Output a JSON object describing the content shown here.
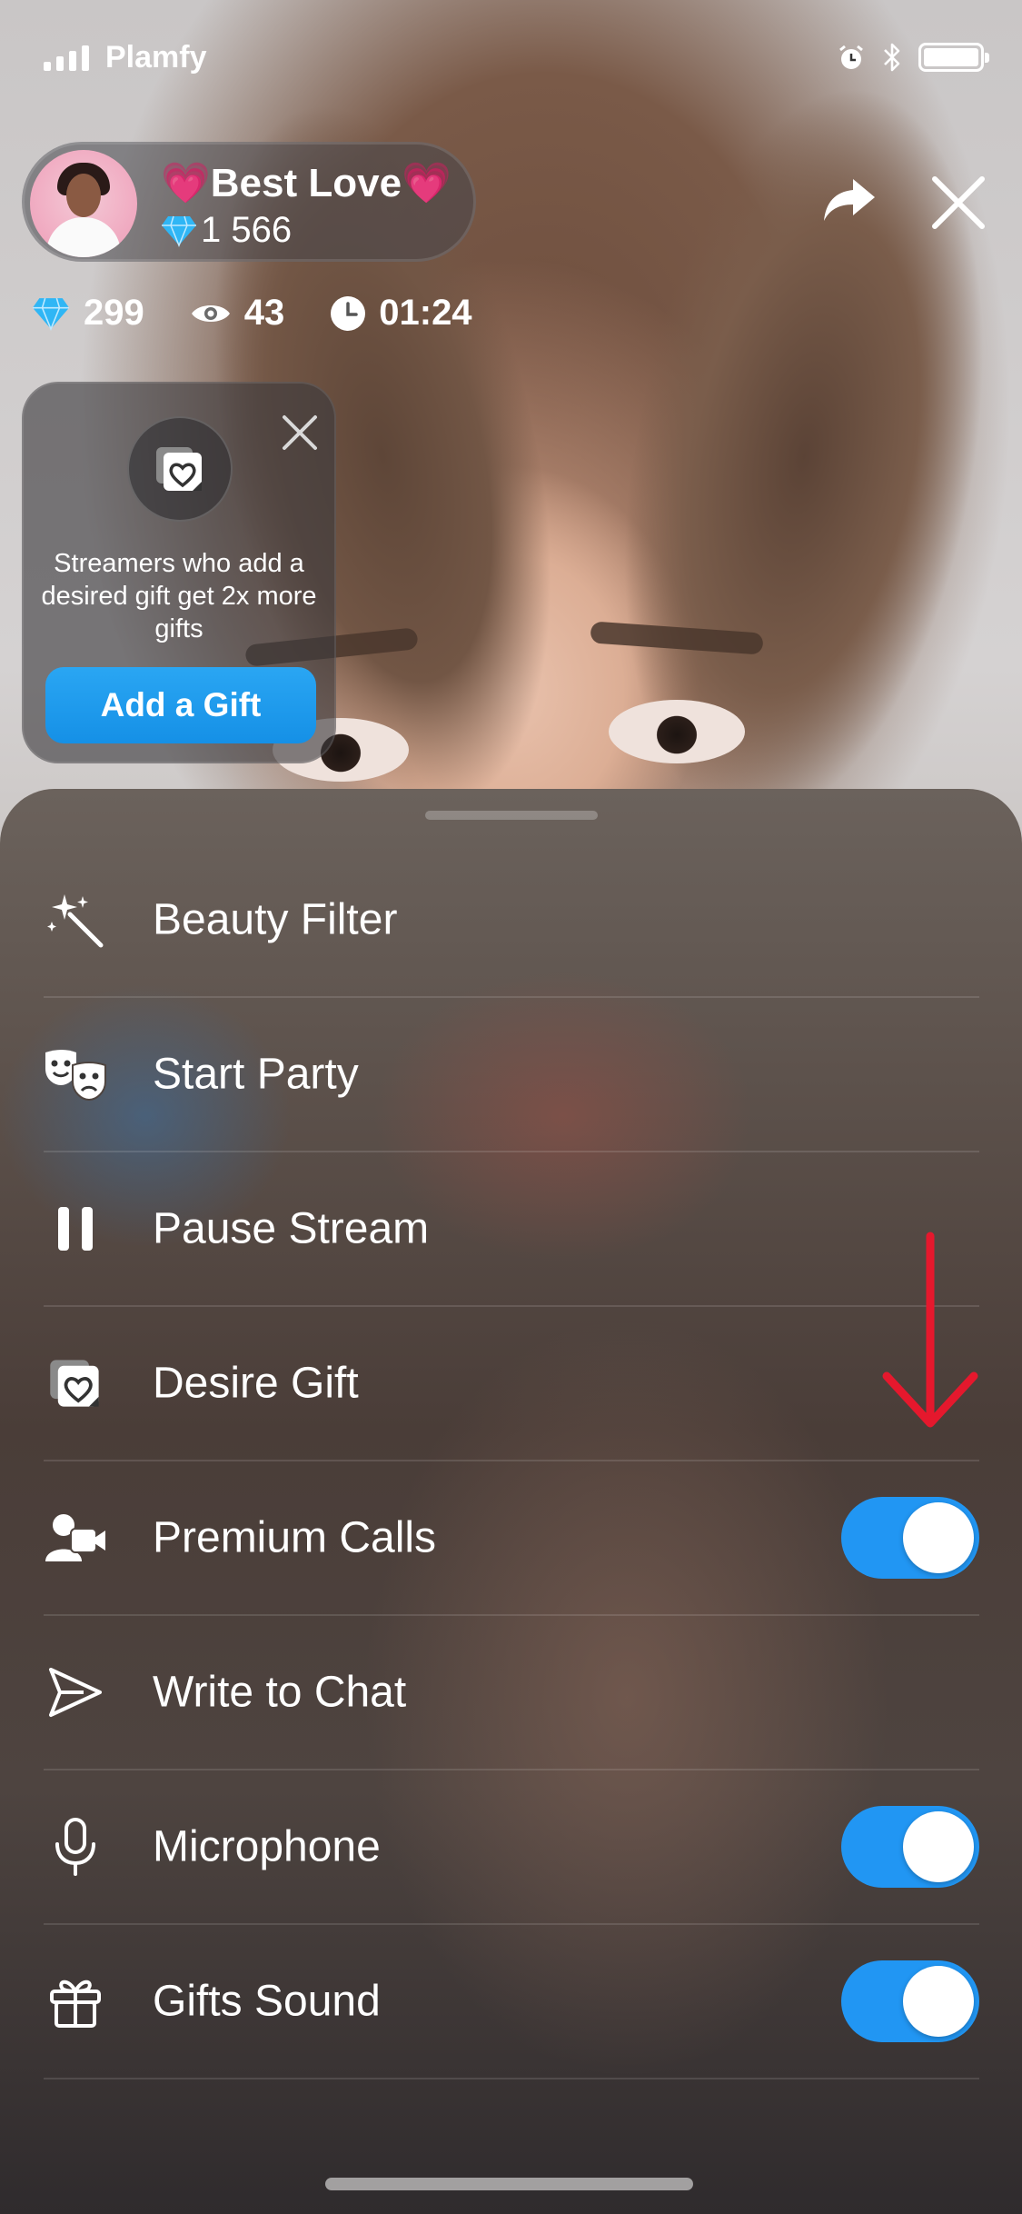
{
  "status_bar": {
    "carrier": "Plamfy",
    "icons": [
      "signal-icon",
      "alarm-icon",
      "bluetooth-icon",
      "battery-icon"
    ],
    "battery_level": 1.0
  },
  "streamer": {
    "name": "💗Best Love💗",
    "score_icon": "diamond-icon",
    "score": "1 566"
  },
  "header_actions": {
    "share_icon": "share-icon",
    "close_icon": "close-icon"
  },
  "stats": {
    "diamonds": "299",
    "viewers": "43",
    "duration": "01:24"
  },
  "gift_tip": {
    "text": "Streamers who add a desired gift get 2x more gifts",
    "button_label": "Add a Gift"
  },
  "menu": [
    {
      "label": "Beauty Filter",
      "icon": "magic-wand-icon"
    },
    {
      "label": "Start Party",
      "icon": "theater-masks-icon"
    },
    {
      "label": "Pause Stream",
      "icon": "pause-icon"
    },
    {
      "label": "Desire Gift",
      "icon": "desire-gift-icon"
    },
    {
      "label": "Premium Calls",
      "icon": "premium-calls-icon",
      "toggle": true
    },
    {
      "label": "Write to Chat",
      "icon": "send-icon"
    },
    {
      "label": "Microphone",
      "icon": "microphone-icon",
      "toggle": true
    },
    {
      "label": "Gifts Sound",
      "icon": "gift-icon",
      "toggle": true
    }
  ],
  "colors": {
    "accent": "#2196f3",
    "button": "#1a9aec",
    "annotation": "#e5182d"
  }
}
